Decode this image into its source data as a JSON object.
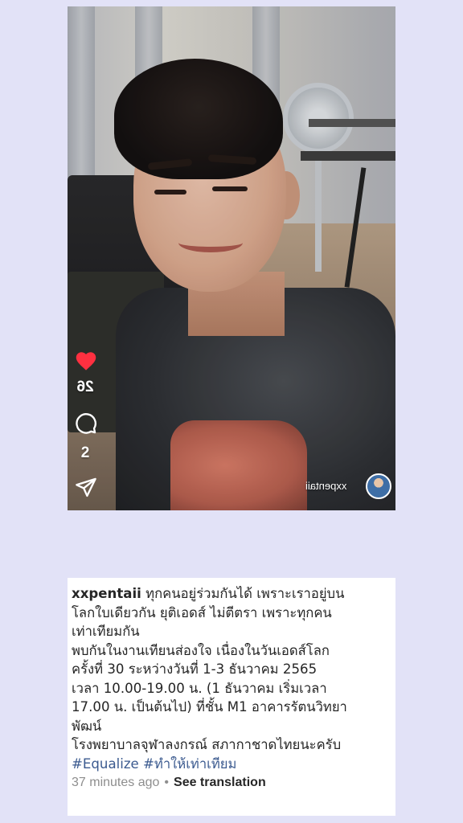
{
  "post": {
    "username": "xxpentaii",
    "like_count": "26",
    "comment_count": "2",
    "caption": {
      "username": "xxpentaii",
      "lines": [
        "ทุกคนอยู่ร่วมกันได้ เพราะเราอยู่บน",
        "โลกใบเดียวกัน ยุติเอดส์ ไม่ตีตรา เพราะทุกคน",
        "เท่าเทียมกัน",
        "พบกันในงานเทียนส่องใจ เนื่องในวันเอดส์โลก",
        "ครั้งที่ 30 ระหว่างวันที่ 1-3 ธันวาคม 2565",
        "เวลา 10.00-19.00 น. (1 ธันวาคม เริ่มเวลา",
        "17.00 น. เป็นต้นไป) ที่ชั้น M1 อาคารรัตนวิทยา",
        "พัฒน์",
        "โรงพยาบาลจุฬาลงกรณ์ สภากาชาดไทยนะครับ"
      ],
      "hashtags": "#Equalize #ทำให้เท่าเทียม"
    },
    "timestamp": "37 minutes ago",
    "separator": "•",
    "see_translation": "See translation"
  },
  "icons": {
    "like": "heart-icon",
    "comment": "comment-icon",
    "share": "paper-plane-icon"
  },
  "colors": {
    "background": "#e2e2f7",
    "heart": "#ff3040",
    "hashtag": "#3b5a8f",
    "timestamp": "#8e8e8e"
  }
}
